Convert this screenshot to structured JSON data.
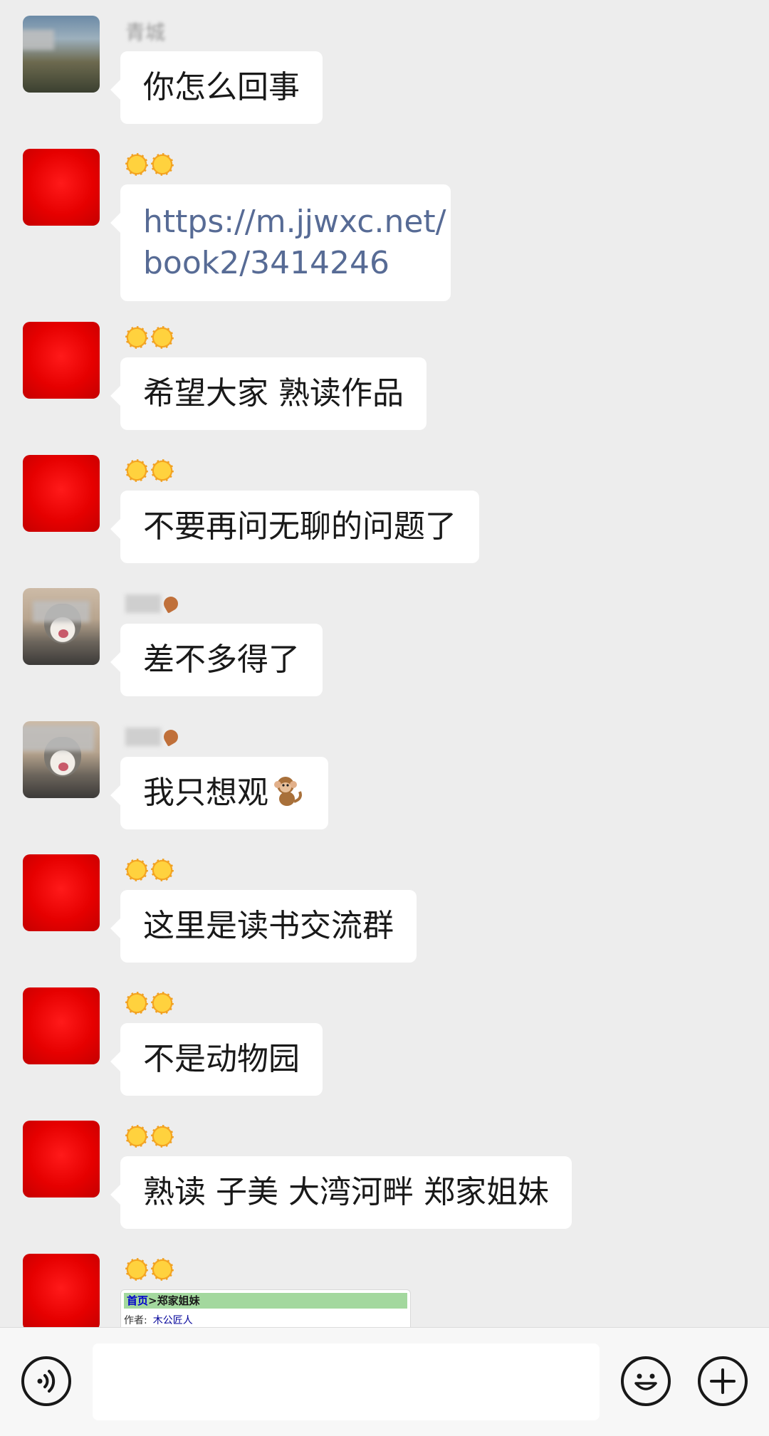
{
  "messages": [
    {
      "sender": "青城",
      "avatar": "landscape",
      "type": "text",
      "text": "你怎么回事"
    },
    {
      "sender": "🌞🌞",
      "avatar": "red",
      "type": "link",
      "text": "https://m.jjwxc.net/book2/3414246"
    },
    {
      "sender": "🌞🌞",
      "avatar": "red",
      "type": "text",
      "text": "希望大家 熟读作品"
    },
    {
      "sender": "🌞🌞",
      "avatar": "red",
      "type": "text",
      "text": "不要再问无聊的问题了"
    },
    {
      "sender": "",
      "avatar": "cat",
      "type": "text",
      "text": "差不多得了"
    },
    {
      "sender": "",
      "avatar": "cat",
      "type": "text",
      "text": "我只想观",
      "emoji": "monkey"
    },
    {
      "sender": "🌞🌞",
      "avatar": "red",
      "type": "text",
      "text": "这里是读书交流群"
    },
    {
      "sender": "🌞🌞",
      "avatar": "red",
      "type": "text",
      "text": "不是动物园"
    },
    {
      "sender": "🌞🌞",
      "avatar": "red",
      "type": "text",
      "text": "熟读 子美 大湾河畔 郑家姐妹"
    },
    {
      "sender": "🌞🌞",
      "avatar": "red",
      "type": "image_card",
      "card": {
        "home": "首页",
        "separator": ">",
        "book_title": "郑家姐妹",
        "author_label": "作者:",
        "author": "木公匠人"
      }
    }
  ],
  "bottom_bar": {
    "voice_icon": "voice-icon",
    "emoji_icon": "smiley-icon",
    "more_icon": "plus-icon",
    "input_value": ""
  },
  "colors": {
    "background": "#ededed",
    "bubble": "#ffffff",
    "link": "#576b95",
    "avatar_red": "#e60000"
  }
}
